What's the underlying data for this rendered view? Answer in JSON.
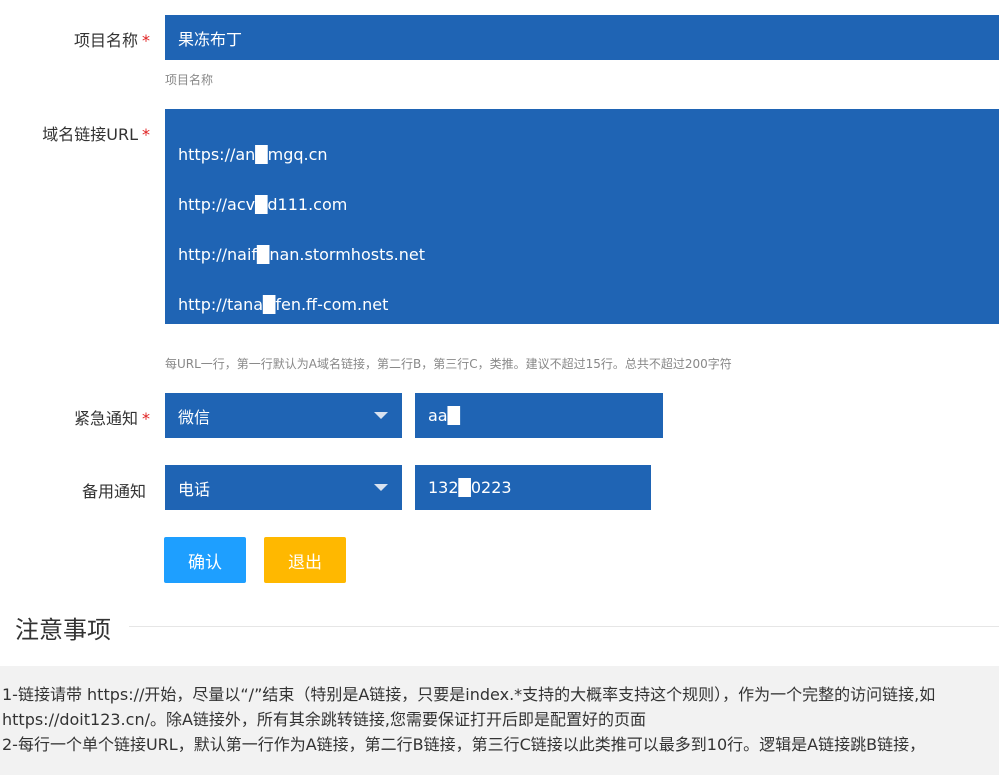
{
  "form": {
    "project": {
      "label": "项目名称",
      "value": "果冻布丁",
      "hint": "项目名称"
    },
    "urls": {
      "label": "域名链接URL",
      "lines": [
        "https://an█mgq.cn",
        "http://acv█d111.com",
        "http://naif█nan.stormhosts.net",
        "http://tana█fen.ff-com.net"
      ],
      "hint": "每URL一行，第一行默认为A域名链接，第二行B，第三行C，类推。建议不超过15行。总共不超过200字符"
    },
    "urgent": {
      "label": "紧急通知",
      "select": "微信",
      "value": "aa█"
    },
    "backup": {
      "label": "备用通知",
      "select": "电话",
      "value": "132█0223"
    },
    "required_mark": "*",
    "buttons": {
      "confirm": "确认",
      "exit": "退出"
    }
  },
  "notes": {
    "title": "注意事项",
    "lines": [
      "1-链接请带 https://开始，尽量以“/”结束（特别是A链接，只要是index.*支持的大概率支持这个规则），作为一个完整的访问链接,如",
      "https://doit123.cn/。除A链接外，所有其余跳转链接,您需要保证打开后即是配置好的页面",
      "2-每行一个单个链接URL，默认第一行作为A链接，第二行B链接，第三行C链接以此类推可以最多到10行。逻辑是A链接跳B链接，"
    ]
  },
  "colors": {
    "field_bg": "#1f64b4",
    "confirm_bg": "#1e9fff",
    "exit_bg": "#ffb800",
    "required": "#e02020"
  }
}
